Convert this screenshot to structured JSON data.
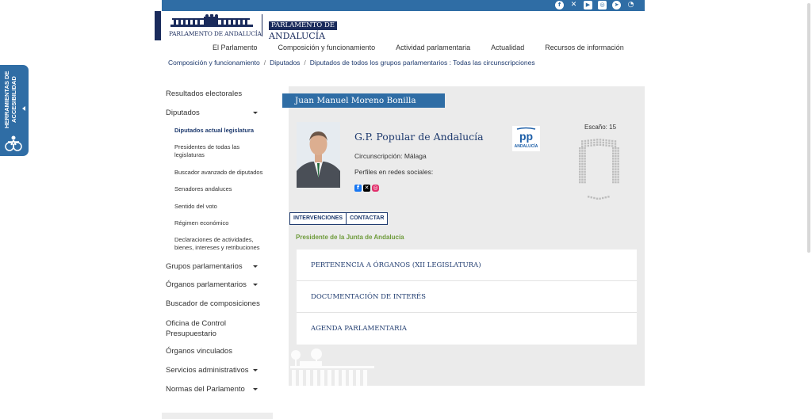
{
  "header": {
    "logo_left_text": "PARLAMENTO DE ANDALUCÍA",
    "logo_right_line1": "PARLAMENTO DE",
    "logo_right_line2": "ANDALUCÍA",
    "social_icons": [
      "facebook-icon",
      "x-icon",
      "youtube-icon",
      "instagram-icon",
      "telegram-icon",
      "rss-icon"
    ]
  },
  "nav": {
    "items": [
      "El Parlamento",
      "Composición y funcionamiento",
      "Actividad parlamentaria",
      "Actualidad",
      "Recursos de información"
    ]
  },
  "breadcrumb": {
    "items": [
      "Composición y funcionamiento",
      "Diputados",
      "Diputados de todos los grupos parlamentarios : Todas las circunscripciones"
    ]
  },
  "accessibility": {
    "label": "HERRAMIENTAS DE ACCESIBILIDAD"
  },
  "sidebar": {
    "items": [
      {
        "label": "Resultados electorales"
      },
      {
        "label": "Diputados"
      },
      {
        "label": "Diputados actual legislatura"
      },
      {
        "label": "Presidentes de todas las legislaturas"
      },
      {
        "label": "Buscador avanzado de diputados"
      },
      {
        "label": "Senadores andaluces"
      },
      {
        "label": "Sentido del voto"
      },
      {
        "label": "Régimen económico"
      },
      {
        "label": "Declaraciones de actividades, bienes, intereses y retribuciones"
      },
      {
        "label": "Grupos parlamentarios"
      },
      {
        "label": "Órganos parlamentarios"
      },
      {
        "label": "Buscador de composiciones"
      },
      {
        "label": "Oficina de Control Presupuestario"
      },
      {
        "label": "Órganos vinculados"
      },
      {
        "label": "Servicios administrativos"
      },
      {
        "label": "Normas del Parlamento"
      }
    ]
  },
  "deputy": {
    "name": "Juan Manuel Moreno Bonilla",
    "group": "G.P. Popular de Andalucía",
    "circumscription": "Circunscripción: Málaga",
    "profiles_label": "Perfiles en redes sociales:",
    "seat": "Escaño: 15",
    "party_logo_letters": "pp",
    "party_logo_sub": "ANDALUCÍA",
    "role": "Presidente de la Junta de Andalucía"
  },
  "tabs": [
    "INTERVENCIONES",
    "CONTACTAR"
  ],
  "accordion": [
    "PERTENENCIA A ÓRGANOS (XII LEGISLATURA)",
    "DOCUMENTACIÓN DE INTERÉS",
    "AGENDA PARLAMENTARIA"
  ],
  "colors": {
    "topbar": "#2f6da5",
    "navy": "#1e3a6e",
    "role_green": "#6e9b3b"
  }
}
